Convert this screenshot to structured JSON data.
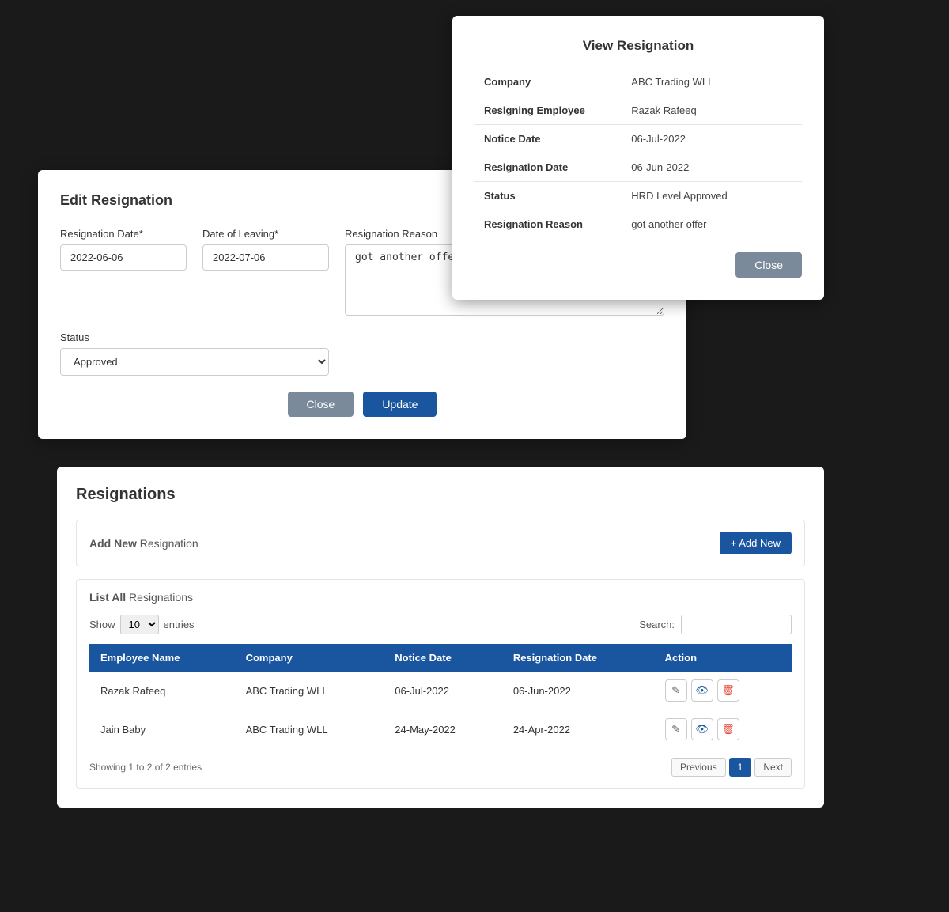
{
  "view_modal": {
    "title": "View Resignation",
    "fields": [
      {
        "label": "Company",
        "value": "ABC Trading WLL"
      },
      {
        "label": "Resigning Employee",
        "value": "Razak Rafeeq"
      },
      {
        "label": "Notice Date",
        "value": "06-Jul-2022"
      },
      {
        "label": "Resignation Date",
        "value": "06-Jun-2022"
      },
      {
        "label": "Status",
        "value": "HRD Level Approved"
      },
      {
        "label": "Resignation Reason",
        "value": "got another offer"
      }
    ],
    "close_btn": "Close"
  },
  "edit_panel": {
    "title": "Edit Resignation",
    "fields": {
      "resignation_date_label": "Resignation Date*",
      "resignation_date_value": "2022-06-06",
      "date_of_leaving_label": "Date of Leaving*",
      "date_of_leaving_value": "2022-07-06",
      "resignation_reason_label": "Resignation Reason",
      "resignation_reason_value": "got another offer",
      "status_label": "Status",
      "status_value": "Approved"
    },
    "close_btn": "Close",
    "update_btn": "Update"
  },
  "resignations": {
    "page_title": "Resignations",
    "add_new_label": "Add New",
    "add_new_sub": "Resignation",
    "add_new_btn": "+ Add New",
    "list_all_label": "List All",
    "list_all_sub": "Resignations",
    "show_label": "Show",
    "entries_label": "entries",
    "search_label": "Search:",
    "show_value": "10",
    "columns": [
      "Employee Name",
      "Company",
      "Notice Date",
      "Resignation Date",
      "Action"
    ],
    "rows": [
      {
        "employee_name": "Razak Rafeeq",
        "company": "ABC Trading WLL",
        "notice_date": "06-Jul-2022",
        "resignation_date": "06-Jun-2022"
      },
      {
        "employee_name": "Jain Baby",
        "company": "ABC Trading WLL",
        "notice_date": "24-May-2022",
        "resignation_date": "24-Apr-2022"
      }
    ],
    "showing_text": "Showing 1 to 2 of 2 entries",
    "prev_btn": "Previous",
    "page_1": "1",
    "next_btn": "Next"
  }
}
